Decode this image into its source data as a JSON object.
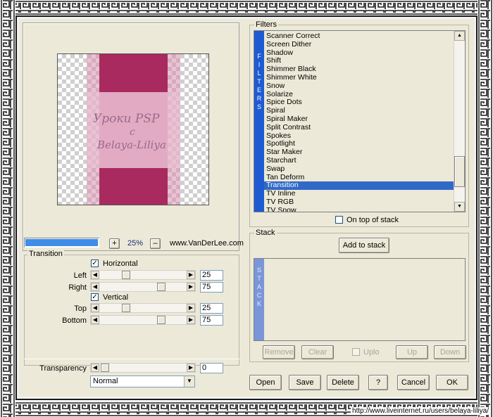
{
  "filters": {
    "title": "Filters",
    "tab_label": "FILTERS",
    "items": [
      "Scanner Correct",
      "Screen Dither",
      "Shadow",
      "Shift",
      "Shimmer Black",
      "Shimmer White",
      "Snow",
      "Solarize",
      "Spice Dots",
      "Spiral",
      "Spiral Maker",
      "Split Contrast",
      "Spokes",
      "Spotlight",
      "Star Maker",
      "Starchart",
      "Swap",
      "Tan Deform",
      "Transition",
      "TV Inline",
      "TV RGB",
      "TV Snow"
    ],
    "selected": "Transition",
    "on_top_label": "On top of stack"
  },
  "stack": {
    "title": "Stack",
    "tab_label": "STACK",
    "add_label": "Add to stack",
    "remove_label": "Remove",
    "clear_label": "Clear",
    "uplo_label": "Uplo",
    "up_label": "Up",
    "down_label": "Down"
  },
  "preview": {
    "watermark_line1": "Уроки PSP",
    "watermark_line2": "с",
    "watermark_line3": "Belaya-Liliya",
    "zoom": "25%",
    "plus": "+",
    "minus": "–",
    "website": "www.VanDerLee.com",
    "progress": 1.0
  },
  "transition": {
    "title": "Transition",
    "horizontal_label": "Horizontal",
    "vertical_label": "Vertical",
    "left_label": "Left",
    "right_label": "Right",
    "top_label": "Top",
    "bottom_label": "Bottom",
    "left_value": "25",
    "right_value": "75",
    "top_value": "25",
    "bottom_value": "75",
    "check": "✓"
  },
  "blend": {
    "transparency_label": "Transparency",
    "transparency_value": "0",
    "mode": "Normal"
  },
  "buttons": {
    "open": "Open",
    "save": "Save",
    "delete": "Delete",
    "help": "?",
    "cancel": "Cancel",
    "ok": "OK"
  },
  "footer": {
    "url": "http://www.liveinternet.ru/users/belaya-liliya/"
  },
  "colors": {
    "magenta": "#a82a5e",
    "pink": "#d88fb0",
    "light_pink": "#ebc1d4",
    "selection": "#3169c6",
    "tab_blue": "#1e5bd1"
  }
}
